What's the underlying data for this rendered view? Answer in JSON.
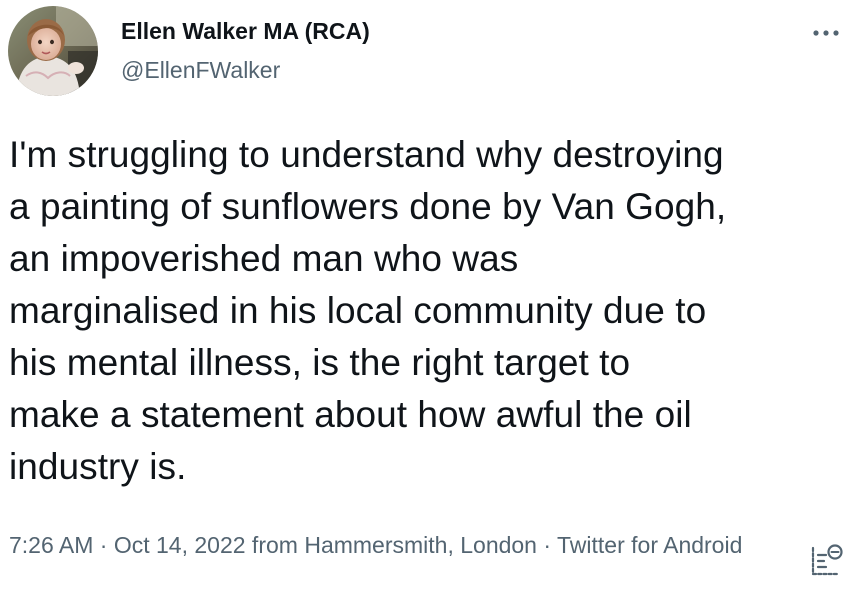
{
  "author": {
    "display_name": "Ellen Walker MA (RCA)",
    "handle": "@EllenFWalker"
  },
  "tweet": {
    "lines": [
      "I'm struggling to understand why destroying",
      "a painting of sunflowers done by Van Gogh,",
      "an impoverished man who was",
      "marginalised in his local community due to",
      "his mental illness, is the right target to",
      "make a statement about how awful the oil",
      "industry is."
    ]
  },
  "meta": {
    "time": "7:26 AM",
    "separator": " · ",
    "date": "Oct 14, 2022",
    "location_prefix": " from ",
    "location": "Hammersmith, London",
    "source": "Twitter for Android"
  },
  "icons": {
    "more": "more-icon",
    "analytics": "analytics-icon",
    "avatar": "avatar"
  },
  "colors": {
    "text": "#0f1419",
    "secondary": "#536471"
  }
}
